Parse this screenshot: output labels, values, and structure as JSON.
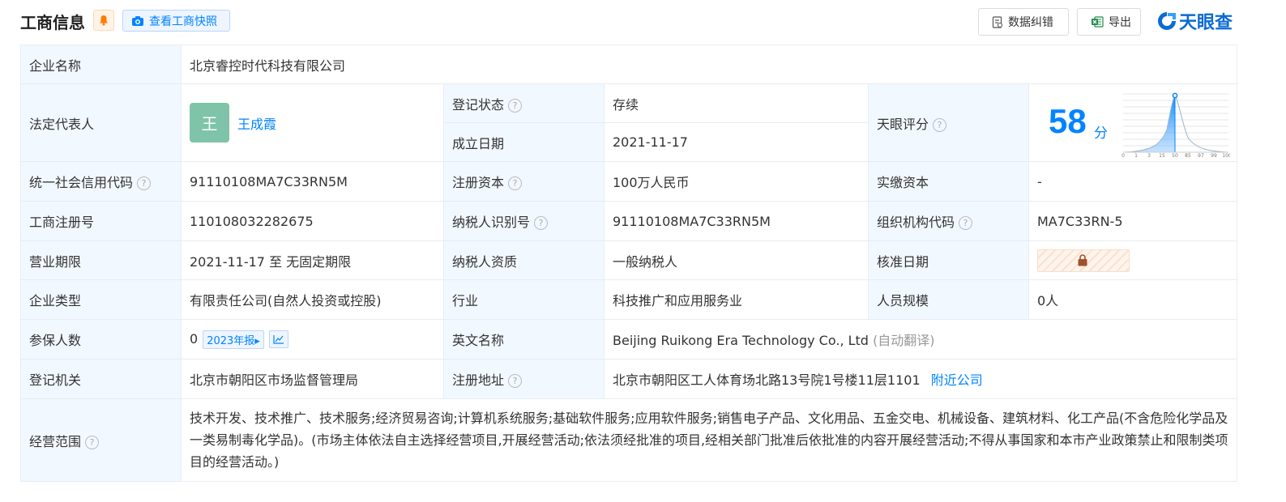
{
  "header": {
    "title": "工商信息",
    "snapshot_label": "查看工商快照",
    "correct_label": "数据纠错",
    "export_label": "导出",
    "logo_text": "天眼查"
  },
  "labels": {
    "company_name": "企业名称",
    "legal_rep": "法定代表人",
    "reg_status": "登记状态",
    "est_date": "成立日期",
    "tianyan_score": "天眼评分",
    "credit_code": "统一社会信用代码",
    "reg_capital": "注册资本",
    "paid_capital": "实缴资本",
    "reg_no": "工商注册号",
    "taxpayer_id": "纳税人识别号",
    "org_code": "组织机构代码",
    "biz_term": "营业期限",
    "taxpayer_qual": "纳税人资质",
    "approval_date": "核准日期",
    "company_type": "企业类型",
    "industry": "行业",
    "staff_size": "人员规模",
    "insured": "参保人数",
    "english_name": "英文名称",
    "reg_authority": "登记机关",
    "reg_address": "注册地址",
    "biz_scope": "经营范围"
  },
  "values": {
    "company_name": "北京睿控时代科技有限公司",
    "legal_rep_avatar": "王",
    "legal_rep_name": "王成霞",
    "reg_status": "存续",
    "est_date": "2021-11-17",
    "score_value": "58",
    "score_unit": "分",
    "score_axis": [
      "0",
      "1",
      "3",
      "15",
      "50",
      "85",
      "97",
      "99",
      "100"
    ],
    "credit_code": "91110108MA7C33RN5M",
    "reg_capital": "100万人民币",
    "paid_capital": "-",
    "reg_no": "110108032282675",
    "taxpayer_id": "91110108MA7C33RN5M",
    "org_code": "MA7C33RN-5",
    "biz_term": "2021-11-17 至 无固定期限",
    "taxpayer_qual": "一般纳税人",
    "company_type": "有限责任公司(自然人投资或控股)",
    "industry": "科技推广和应用服务业",
    "staff_size": "0人",
    "insured_count": "0",
    "insured_year_tag": "2023年报",
    "english_name": "Beijing Ruikong Era Technology Co., Ltd",
    "english_name_note": "(自动翻译)",
    "reg_authority": "北京市朝阳区市场监督管理局",
    "reg_address": "北京市朝阳区工人体育场北路13号院1号楼11层1101",
    "nearby_link": "附近公司",
    "biz_scope": "技术开发、技术推广、技术服务;经济贸易咨询;计算机系统服务;基础软件服务;应用软件服务;销售电子产品、文化用品、五金交电、机械设备、建筑材料、化工产品(不含危险化学品及一类易制毒化学品)。(市场主体依法自主选择经营项目,开展经营活动;依法须经批准的项目,经相关部门批准后依批准的内容开展经营活动;不得从事国家和本市产业政策禁止和限制类项目的经营活动。)"
  },
  "colors": {
    "accent": "#0084ff",
    "status_green": "#1aa15f",
    "label_bg": "#f2f8ff",
    "avatar_bg": "#7fc4a8"
  },
  "icons": {
    "bell": "bell-icon",
    "camera": "camera-icon",
    "correct": "document-edit-icon",
    "export": "excel-icon",
    "question": "question-icon",
    "trend": "trend-chart-icon",
    "lock": "lock-icon"
  }
}
